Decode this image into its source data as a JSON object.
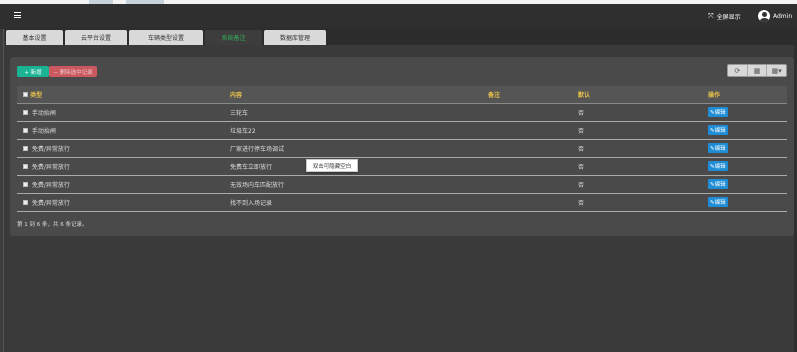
{
  "header": {
    "fullscreen_label": "全屏显示",
    "fullscreen_icon": "expand-icon",
    "user_name": "Admin"
  },
  "tabs": [
    {
      "label": "基本设置",
      "active": false
    },
    {
      "label": "云平台设置",
      "active": false
    },
    {
      "label": "车辆类型设置",
      "active": false
    },
    {
      "label": "系统备注",
      "active": true
    },
    {
      "label": "数据库管理",
      "active": false
    }
  ],
  "toolbar": {
    "add_label": "+ 新增",
    "delete_label": "− 删除选中记录",
    "tools": [
      "refresh-icon",
      "columns-icon",
      "grid-dropdown-icon"
    ]
  },
  "table": {
    "headers": [
      "类型",
      "内容",
      "备注",
      "默认",
      "操作"
    ],
    "rows": [
      {
        "type": "手动抬闸",
        "content": "三轮车",
        "remark": "",
        "default": "否",
        "action": "编辑"
      },
      {
        "type": "手动抬闸",
        "content": "垃圾车22",
        "remark": "",
        "default": "否",
        "action": "编辑"
      },
      {
        "type": "免费/异常放行",
        "content": "厂家进行停车场调试",
        "remark": "",
        "default": "否",
        "action": "编辑"
      },
      {
        "type": "免费/异常放行",
        "content": "免费车立即放行",
        "remark": "",
        "default": "否",
        "action": "编辑"
      },
      {
        "type": "免费/异常放行",
        "content": "无效场内车匹配放行",
        "remark": "",
        "default": "否",
        "action": "编辑"
      },
      {
        "type": "免费/异常放行",
        "content": "找不到入场记录",
        "remark": "",
        "default": "否",
        "action": "编辑"
      }
    ]
  },
  "tooltip": "双击可隐藏空白",
  "footer": "第 1 到 6 条，共 6 条记录。",
  "colors": {
    "header_text": "#e8c24a",
    "add_button": "#1ab394",
    "delete_button": "#c9595f",
    "edit_button": "#1f8dd6",
    "active_tab": "#33b15a"
  }
}
